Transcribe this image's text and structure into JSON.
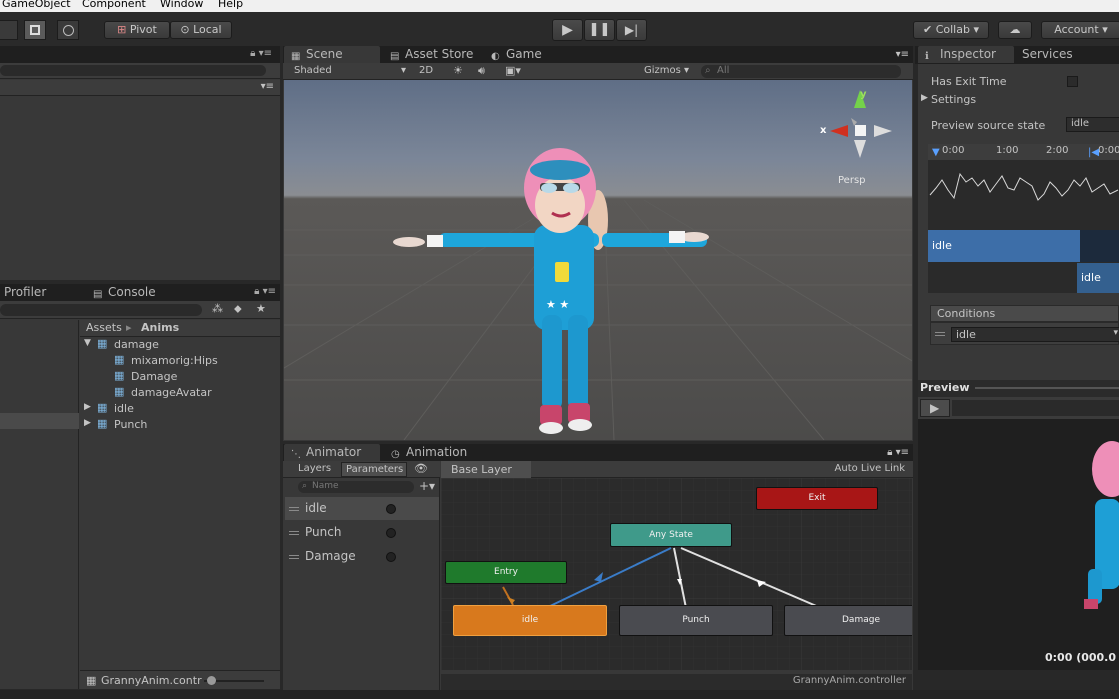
{
  "menu": {
    "gameobject": "GameObject",
    "component": "Component",
    "window": "Window",
    "help": "Help"
  },
  "toolbar": {
    "pivot": "Pivot",
    "local": "Local",
    "collab": "Collab ▾",
    "account": "Account ▾"
  },
  "left_top_panel": {},
  "bottom_left": {
    "tabs": {
      "profiler": "Profiler",
      "console": "Console"
    },
    "breadcrumb": {
      "root": "Assets",
      "sep": "▸",
      "current": "Anims"
    },
    "tree": [
      {
        "label": "damage",
        "depth": 0,
        "arrow": "▼"
      },
      {
        "label": "mixamorig:Hips",
        "depth": 1,
        "arrow": ""
      },
      {
        "label": "Damage",
        "depth": 1,
        "arrow": ""
      },
      {
        "label": "damageAvatar",
        "depth": 1,
        "arrow": ""
      },
      {
        "label": "idle",
        "depth": 0,
        "arrow": "▶"
      },
      {
        "label": "Punch",
        "depth": 0,
        "arrow": "▶"
      }
    ],
    "footer": "GrannyAnim.contr"
  },
  "scene": {
    "tabs": {
      "scene": "Scene",
      "asset_store": "Asset Store",
      "game": "Game"
    },
    "shading": "Shaded",
    "mode_2d": "2D",
    "gizmos": "Gizmos ▾",
    "search_placeholder": "All",
    "axis_y": "y",
    "axis_x": "x",
    "persp": "Persp"
  },
  "animator": {
    "tabs": {
      "animator": "Animator",
      "animation": "Animation"
    },
    "sub_tabs": {
      "layers": "Layers",
      "parameters": "Parameters"
    },
    "layer": "Base Layer",
    "auto_live_link": "Auto Live Link",
    "search_placeholder": "Name",
    "parameters": [
      "idle",
      "Punch",
      "Damage"
    ],
    "nodes": {
      "exit": "Exit",
      "any_state": "Any State",
      "entry": "Entry",
      "idle": "idle",
      "punch": "Punch",
      "damage": "Damage"
    },
    "footer": "GrannyAnim.controller"
  },
  "inspector": {
    "tabs": {
      "inspector": "Inspector",
      "services": "Services"
    },
    "has_exit_time": "Has Exit Time",
    "settings": "Settings",
    "preview_source_label": "Preview source state",
    "preview_source_value": "idle",
    "timeline_ticks": [
      "0:00",
      "1:00",
      "2:00",
      "0:00"
    ],
    "track_top": "idle",
    "track_bottom": "idle",
    "conditions": "Conditions",
    "condition_value": "idle",
    "preview": "Preview",
    "time_readout": "0:00 (000.0"
  },
  "colors": {
    "accent": "#3d6ea8",
    "entry": "#1f7a2c",
    "exit": "#a81616",
    "anystate": "#3f9a8a",
    "idle_node": "#d8791d"
  }
}
